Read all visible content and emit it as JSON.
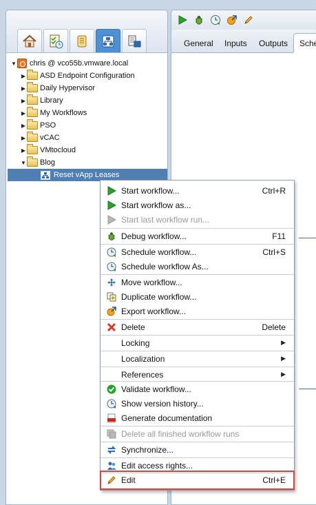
{
  "left_panel": {
    "nav_tabs": [
      {
        "icon": "home-icon"
      },
      {
        "icon": "checklist-clock-icon"
      },
      {
        "icon": "scroll-icon"
      },
      {
        "icon": "workflow-hierarchy-icon"
      },
      {
        "icon": "inventory-icon"
      }
    ],
    "tree": {
      "root": "chris @ vco55b.vmware.local",
      "folders": [
        "ASD Endpoint Configuration",
        "Daily Hypervisor",
        "Library",
        "My Workflows",
        "PSO",
        "vCAC",
        "VMtocloud",
        "Blog"
      ],
      "selected_item": "Reset vApp Leases"
    }
  },
  "right_panel": {
    "toolbar_icons": [
      "run-icon",
      "debug-bug-icon",
      "schedule-clock-icon",
      "export-icon",
      "edit-pencil-icon"
    ],
    "tabs": [
      "General",
      "Inputs",
      "Outputs",
      "Sche"
    ]
  },
  "context_menu": {
    "items": [
      {
        "label": "Start workflow...",
        "shortcut": "Ctrl+R",
        "icon": "play-icon"
      },
      {
        "label": "Start workflow as...",
        "shortcut": "",
        "icon": "play-icon"
      },
      {
        "label": "Start last workflow run...",
        "shortcut": "",
        "icon": "play-disabled-icon",
        "disabled": true
      },
      {
        "label": "Debug workflow...",
        "shortcut": "F11",
        "icon": "bug-icon"
      },
      {
        "label": "Schedule workflow...",
        "shortcut": "Ctrl+S",
        "icon": "clock-icon"
      },
      {
        "label": "Schedule workflow As...",
        "shortcut": "",
        "icon": "clock-icon"
      },
      {
        "label": "Move workflow...",
        "shortcut": "",
        "icon": "move-icon"
      },
      {
        "label": "Duplicate workflow...",
        "shortcut": "",
        "icon": "duplicate-icon"
      },
      {
        "label": "Export workflow...",
        "shortcut": "",
        "icon": "export-icon"
      },
      {
        "label": "Delete",
        "shortcut": "Delete",
        "icon": "delete-icon"
      },
      {
        "label": "Locking",
        "shortcut": "",
        "submenu": true
      },
      {
        "label": "Localization",
        "shortcut": "",
        "submenu": true
      },
      {
        "label": "References",
        "shortcut": "",
        "submenu": true
      },
      {
        "label": "Validate workflow...",
        "shortcut": "",
        "icon": "check-icon"
      },
      {
        "label": "Show version history...",
        "shortcut": "",
        "icon": "history-icon"
      },
      {
        "label": "Generate documentation",
        "shortcut": "",
        "icon": "pdf-icon"
      },
      {
        "label": "Delete all finished workflow runs",
        "shortcut": "",
        "icon": "delete-runs-icon",
        "disabled": true
      },
      {
        "label": "Synchronize...",
        "shortcut": "",
        "icon": "sync-icon"
      },
      {
        "label": "Edit access rights...",
        "shortcut": "",
        "icon": "users-icon"
      },
      {
        "label": "Edit",
        "shortcut": "Ctrl+E",
        "icon": "pencil-icon"
      }
    ]
  },
  "colors": {
    "background": "#c9d6e6",
    "selection": "#4f7fb3",
    "active_tab": "#4c90d6",
    "highlight_border": "#d9443a"
  }
}
